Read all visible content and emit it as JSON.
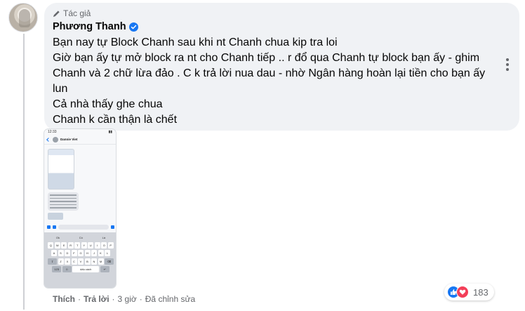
{
  "comment": {
    "author_badge": "Tác giả",
    "author_name": "Phương Thanh",
    "lines": [
      "Bạn nay tự Block Chanh sau khi nt Chanh chua kip tra loi",
      "Giờ bạn ấy tự mở block ra nt cho Chanh tiếp .. r đổ qua Chanh tự block bạn ấy - ghim Chanh và 2 chữ lừa đảo . C k trả lời nua dau - nhờ Ngân hàng hoàn lại tiền cho bạn ấy lun",
      "Cả nhà thấy ghe chua",
      "Chanh k cần thận là chết"
    ],
    "attachment": {
      "status_time": "12:33",
      "chat_name": "Dannie Viet",
      "keyboard_suggestions": [
        "Ok",
        "Có",
        "Là"
      ],
      "keyboard_row1": [
        "Q",
        "W",
        "E",
        "R",
        "T",
        "Y",
        "U",
        "I",
        "O",
        "P"
      ],
      "keyboard_row2": [
        "A",
        "S",
        "D",
        "F",
        "G",
        "H",
        "J",
        "K",
        "L"
      ],
      "keyboard_row3": [
        "Z",
        "X",
        "C",
        "V",
        "B",
        "N",
        "M"
      ],
      "space_label": "dấu cách",
      "num_label": "123"
    },
    "footer": {
      "like": "Thích",
      "reply": "Trả lời",
      "time": "3 giờ",
      "edited": "Đã chỉnh sửa"
    },
    "reactions": {
      "types": [
        "like-icon",
        "love-icon"
      ],
      "count": "183"
    }
  },
  "colors": {
    "bubble": "#f0f2f5",
    "accent": "#1877f2",
    "love": "#f33e58",
    "muted": "#65676b"
  }
}
